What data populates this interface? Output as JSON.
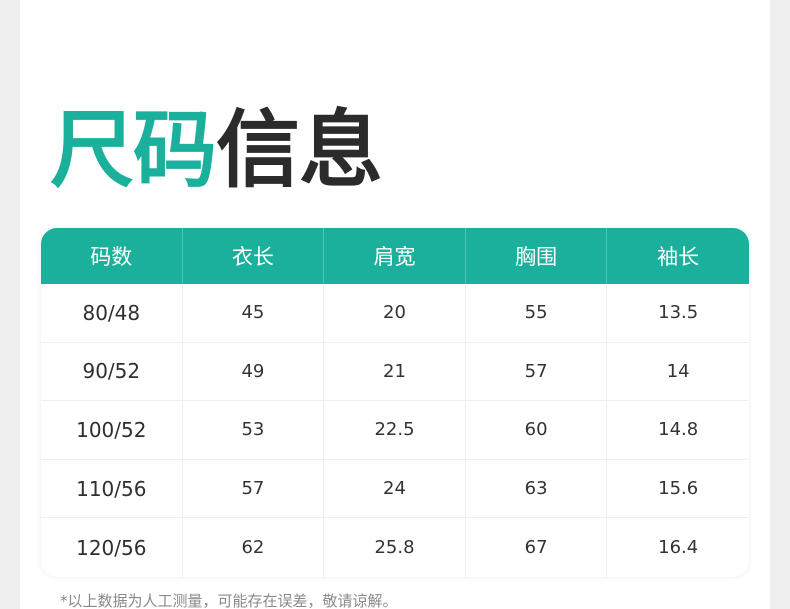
{
  "title": {
    "accent": "尺码",
    "rest": "信息"
  },
  "colors": {
    "accent": "#1ab09c",
    "title_dark": "#2b2b2b"
  },
  "table": {
    "headers": [
      "码数",
      "衣长",
      "肩宽",
      "胸围",
      "袖长"
    ],
    "rows": [
      [
        "80/48",
        "45",
        "20",
        "55",
        "13.5"
      ],
      [
        "90/52",
        "49",
        "21",
        "57",
        "14"
      ],
      [
        "100/52",
        "53",
        "22.5",
        "60",
        "14.8"
      ],
      [
        "110/56",
        "57",
        "24",
        "63",
        "15.6"
      ],
      [
        "120/56",
        "62",
        "25.8",
        "67",
        "16.4"
      ]
    ]
  },
  "note": "*以上数据为人工测量，可能存在误差，敬请谅解。"
}
